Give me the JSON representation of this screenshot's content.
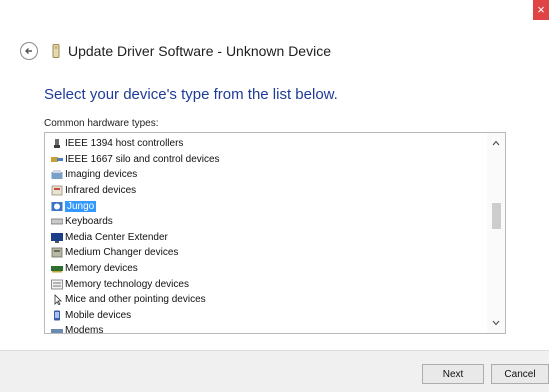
{
  "window": {
    "close_glyph": "×",
    "title": "Update Driver Software - Unknown Device"
  },
  "main": {
    "heading": "Select your device's type from the list below.",
    "list_label": "Common hardware types:",
    "items": [
      {
        "label": "IEEE 1394 host controllers",
        "icon": "ieee1394-icon"
      },
      {
        "label": "IEEE 1667 silo and control devices",
        "icon": "ieee1667-icon"
      },
      {
        "label": "Imaging devices",
        "icon": "imaging-device-icon"
      },
      {
        "label": "Infrared devices",
        "icon": "infrared-device-icon"
      },
      {
        "label": "Jungo",
        "icon": "jungo-icon",
        "selected": true
      },
      {
        "label": "Keyboards",
        "icon": "keyboard-icon"
      },
      {
        "label": "Media Center Extender",
        "icon": "media-center-icon"
      },
      {
        "label": "Medium Changer devices",
        "icon": "medium-changer-icon"
      },
      {
        "label": "Memory devices",
        "icon": "memory-device-icon"
      },
      {
        "label": "Memory technology devices",
        "icon": "memory-technology-icon"
      },
      {
        "label": "Mice and other pointing devices",
        "icon": "mouse-icon"
      },
      {
        "label": "Mobile devices",
        "icon": "mobile-device-icon"
      },
      {
        "label": "Modems",
        "icon": "modem-icon"
      }
    ]
  },
  "footer": {
    "next_label": "Next",
    "cancel_label": "Cancel"
  },
  "colors": {
    "heading": "#1f3b9a",
    "selection": "#3399ff",
    "close": "#e04343"
  }
}
